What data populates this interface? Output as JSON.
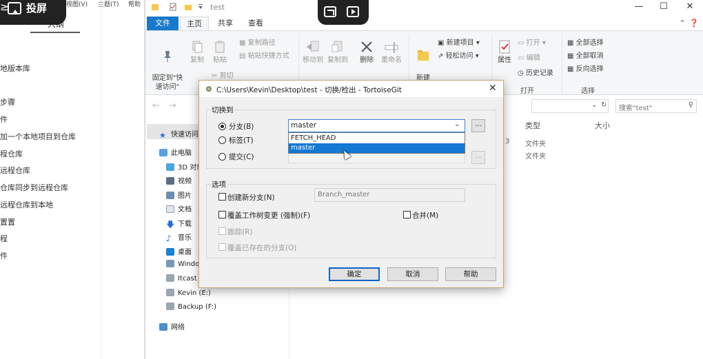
{
  "left_pane": {
    "menubar": [
      "视图(V)",
      "主题(T)",
      "帮助"
    ],
    "outline_tab": "大纲",
    "items": [
      "地版本库",
      "步骤",
      "件",
      "加一个本地项目到仓库",
      "程仓库",
      "远程仓库",
      "仓库同步到远程仓库",
      "远程仓库到本地",
      "置置",
      "程",
      "件"
    ]
  },
  "cast_toolbar": {
    "lead_glyph": "≥",
    "label": "投屏"
  },
  "explorer": {
    "title": "test",
    "tabs": [
      "文件",
      "主页",
      "共享",
      "查看"
    ],
    "ribbon": {
      "pin_quick": "固定到\"快\n速访问\"",
      "copy": "复制",
      "paste": "粘贴",
      "copy_path": "复制路径",
      "paste_shortcut": "粘贴快捷方式",
      "cut": "剪切",
      "move_to": "移动到",
      "copy_to": "复制到",
      "delete": "删除",
      "rename": "重命名",
      "new_folder": "新建\n文件夹",
      "new_item": "新建项目 ▾",
      "easy_access": "轻松访问 ▾",
      "properties": "属性",
      "open": "打开 ▾",
      "edit": "编辑",
      "history": "历史记录",
      "group_open": "打开",
      "select_all": "全部选择",
      "select_none": "全部取消",
      "invert_selection": "反向选择",
      "group_select": "选择"
    },
    "search_placeholder": "搜索\"test\"",
    "tree": {
      "quick_access": "快速访问",
      "this_pc": "此电脑",
      "items": [
        "3D 对象",
        "视频",
        "图片",
        "文档",
        "下载",
        "音乐",
        "桌面",
        "Windo",
        "Itcast (",
        "Kevin (E:)",
        "Backup (F:)"
      ],
      "network": "网络"
    },
    "columns": {
      "type": "类型",
      "size": "大小"
    },
    "rows": [
      {
        "date_tail": "3",
        "type": "文件夹"
      },
      {
        "date_tail": "",
        "type": "文件夹"
      }
    ]
  },
  "dialog": {
    "title": "C:\\Users\\Kevin\\Desktop\\test - 切换/检出 - TortoiseGit",
    "switch_group": "切换到",
    "radio_branch": "分支(B)",
    "radio_tag": "标签(T)",
    "radio_commit": "提交(C)",
    "combo_value": "master",
    "dropdown": [
      "FETCH_HEAD",
      "master"
    ],
    "dots": "...",
    "options_group": "选项",
    "create_branch": "创建新分支(N)",
    "branch_name": "Branch_master",
    "override": "覆盖工作树变更 (强制)(F)",
    "merge": "合并(M)",
    "track": "跟踪(R)",
    "override_branch": "覆盖已存在的分支(O)",
    "ok": "确定",
    "cancel": "取消",
    "help": "帮助"
  }
}
